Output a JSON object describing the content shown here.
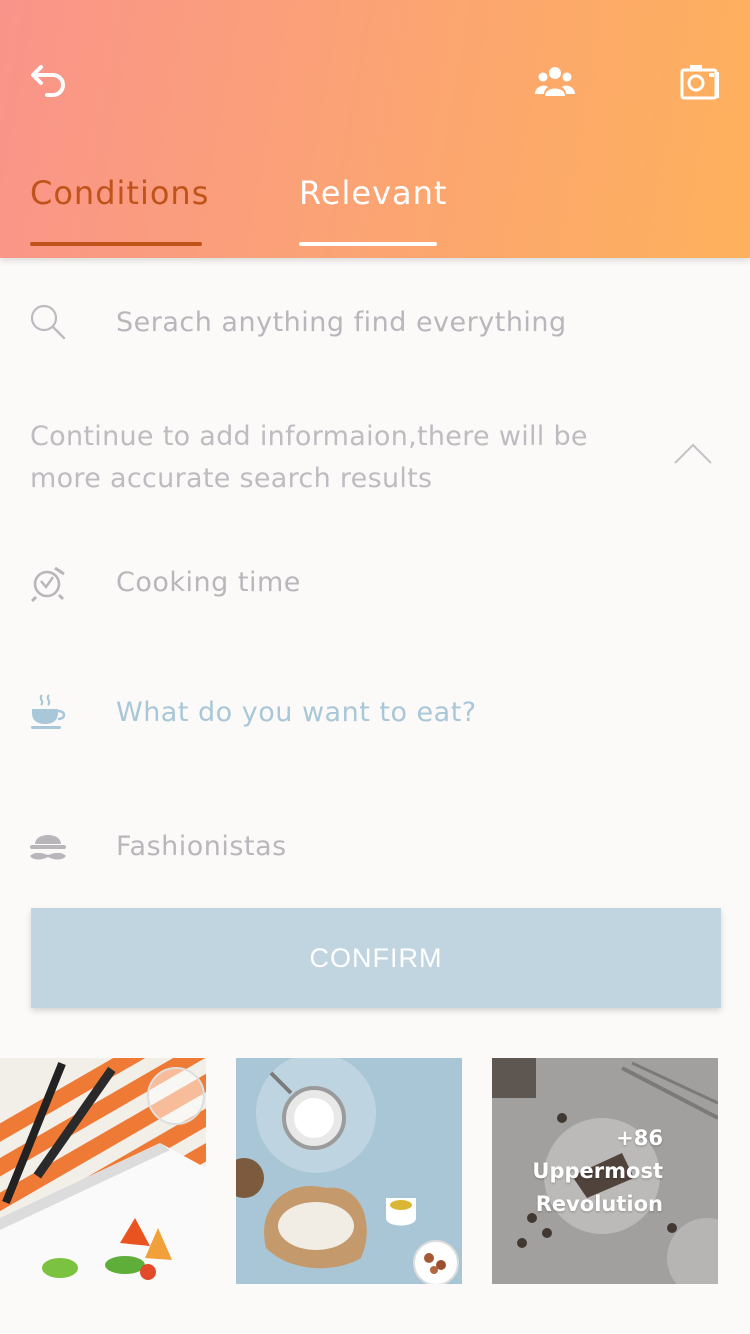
{
  "header": {
    "icons": {
      "back": "back-arrow-icon",
      "group": "group-icon",
      "camera": "camera-icon"
    },
    "tabs": [
      {
        "label": "Conditions",
        "active": true
      },
      {
        "label": "Relevant",
        "active": false
      }
    ]
  },
  "search": {
    "placeholder": "Serach anything find everything",
    "icon": "search-icon"
  },
  "hint": {
    "text": "Continue to add informaion,there will be more accurate search results"
  },
  "filters": [
    {
      "label": "Cooking time",
      "icon": "stopwatch-icon"
    },
    {
      "label": "What do you want to eat?",
      "icon": "coffee-cup-icon"
    },
    {
      "label": "Fashionistas",
      "icon": "hat-mustache-icon"
    }
  ],
  "confirm": {
    "label": "CONFIRM"
  },
  "gallery": {
    "more_count": "+86",
    "more_line1": "Uppermost",
    "more_line2": "Revolution"
  },
  "colors": {
    "header_start": "#f9948a",
    "header_end": "#feb15c",
    "active_tab": "#c0531a",
    "confirm_bg": "#c1d5e1",
    "accent_blue": "#a8c7d8"
  }
}
